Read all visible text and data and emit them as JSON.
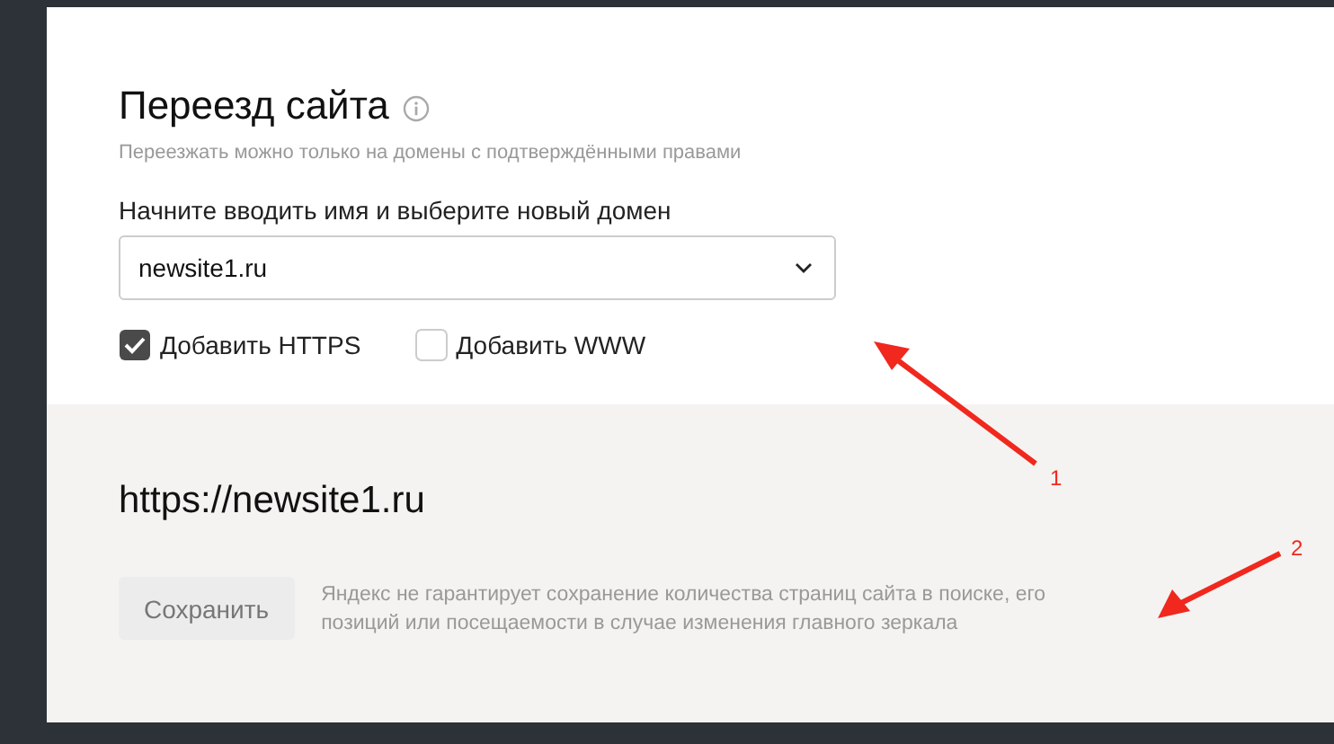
{
  "title": "Переезд сайта",
  "subtitle": "Переезжать можно только на домены с подтверждёнными правами",
  "domain_field": {
    "label": "Начните вводить имя и выберите новый домен",
    "value": "newsite1.ru"
  },
  "options": [
    {
      "label": "Добавить HTTPS",
      "checked": true
    },
    {
      "label": "Добавить WWW",
      "checked": false
    }
  ],
  "result_url": "https://newsite1.ru",
  "save_button": {
    "label": "Сохранить",
    "disabled": true
  },
  "note": "Яндекс не гарантирует сохранение количества страниц сайта в поиске, его позиций или посещаемости в случае изменения главного зеркала",
  "annotations": [
    {
      "label": "1"
    },
    {
      "label": "2"
    }
  ]
}
